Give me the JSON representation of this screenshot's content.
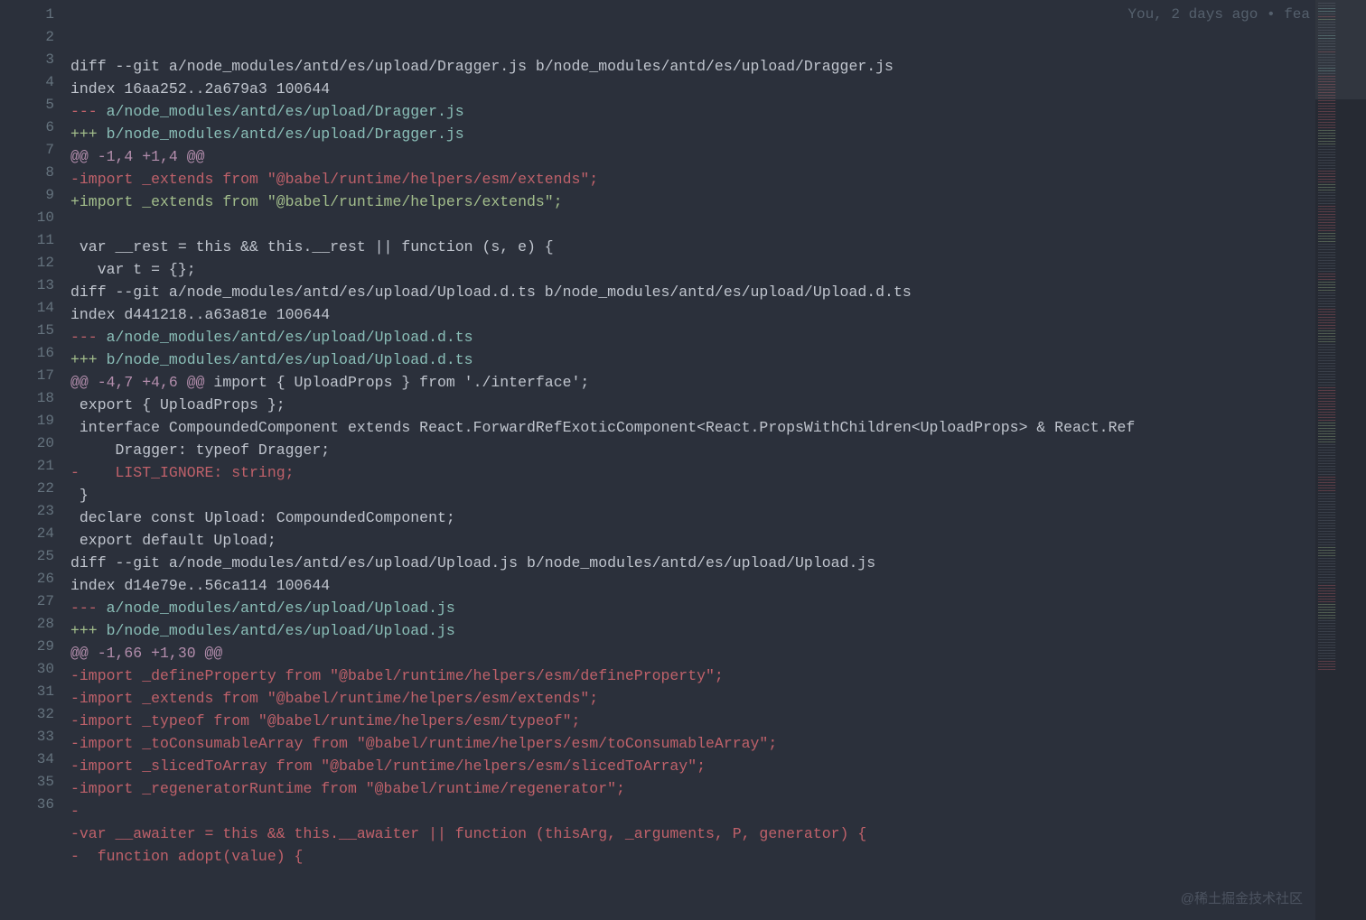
{
  "blame": "You, 2 days ago • fea",
  "watermark": "@稀土掘金技术社区",
  "lines": [
    {
      "n": 1,
      "cls": "header",
      "spans": [
        {
          "c": "c-plain",
          "t": "diff --git a/node_modules/antd/es/upload/Dragger.js b/node_modules/antd/es/upload/Dragger.js"
        }
      ]
    },
    {
      "n": 2,
      "cls": "header",
      "spans": [
        {
          "c": "c-plain",
          "t": "index 16aa252..2a679a3 100644"
        }
      ]
    },
    {
      "n": 3,
      "cls": "minusf",
      "spans": [
        {
          "c": "c-minusfile",
          "t": "--- "
        },
        {
          "c": "c-minuspath",
          "t": "a/node_modules/antd/es/upload/Dragger.js"
        }
      ]
    },
    {
      "n": 4,
      "cls": "plusf",
      "spans": [
        {
          "c": "c-plus",
          "t": "+++ "
        },
        {
          "c": "c-pluspath",
          "t": "b/node_modules/antd/es/upload/Dragger.js"
        }
      ]
    },
    {
      "n": 5,
      "cls": "hunk",
      "spans": [
        {
          "c": "c-hunk",
          "t": "@@ -1,4 +1,4 @@"
        }
      ]
    },
    {
      "n": 6,
      "cls": "del",
      "spans": [
        {
          "c": "c-deleted",
          "t": "-import _extends from \"@babel/runtime/helpers/esm/extends\";"
        }
      ]
    },
    {
      "n": 7,
      "cls": "add",
      "spans": [
        {
          "c": "c-added",
          "t": "+import _extends from \"@babel/runtime/helpers/extends\";"
        }
      ]
    },
    {
      "n": 8,
      "cls": "ctx",
      "spans": [
        {
          "c": "c-plain",
          "t": " "
        }
      ]
    },
    {
      "n": 9,
      "cls": "ctx",
      "spans": [
        {
          "c": "c-plain",
          "t": " var __rest = this && this.__rest || function (s, e) {"
        }
      ]
    },
    {
      "n": 10,
      "cls": "ctx",
      "spans": [
        {
          "c": "c-plain",
          "t": "   var t = {};"
        }
      ]
    },
    {
      "n": 11,
      "cls": "header",
      "spans": [
        {
          "c": "c-plain",
          "t": "diff --git a/node_modules/antd/es/upload/Upload.d.ts b/node_modules/antd/es/upload/Upload.d.ts"
        }
      ]
    },
    {
      "n": 12,
      "cls": "header",
      "spans": [
        {
          "c": "c-plain",
          "t": "index d441218..a63a81e 100644"
        }
      ]
    },
    {
      "n": 13,
      "cls": "minusf",
      "spans": [
        {
          "c": "c-minusfile",
          "t": "--- "
        },
        {
          "c": "c-minuspath",
          "t": "a/node_modules/antd/es/upload/Upload.d.ts"
        }
      ]
    },
    {
      "n": 14,
      "cls": "plusf",
      "spans": [
        {
          "c": "c-plus",
          "t": "+++ "
        },
        {
          "c": "c-pluspath",
          "t": "b/node_modules/antd/es/upload/Upload.d.ts"
        }
      ]
    },
    {
      "n": 15,
      "cls": "hunk",
      "spans": [
        {
          "c": "c-hunk",
          "t": "@@ -4,7 +4,6 @@"
        },
        {
          "c": "c-plain",
          "t": " import { UploadProps } from './interface';"
        }
      ]
    },
    {
      "n": 16,
      "cls": "ctx",
      "spans": [
        {
          "c": "c-plain",
          "t": " export { UploadProps };"
        }
      ]
    },
    {
      "n": 17,
      "cls": "ctx",
      "spans": [
        {
          "c": "c-plain",
          "t": " interface CompoundedComponent extends React.ForwardRefExoticComponent<React.PropsWithChildren<UploadProps> & React.Ref"
        }
      ]
    },
    {
      "n": 18,
      "cls": "ctx",
      "spans": [
        {
          "c": "c-plain",
          "t": "     Dragger: typeof Dragger;"
        }
      ]
    },
    {
      "n": 19,
      "cls": "del",
      "spans": [
        {
          "c": "c-deleted",
          "t": "-    LIST_IGNORE: string;"
        }
      ]
    },
    {
      "n": 20,
      "cls": "ctx",
      "spans": [
        {
          "c": "c-plain",
          "t": " }"
        }
      ]
    },
    {
      "n": 21,
      "cls": "ctx",
      "spans": [
        {
          "c": "c-plain",
          "t": " declare const Upload: CompoundedComponent;"
        }
      ]
    },
    {
      "n": 22,
      "cls": "ctx",
      "spans": [
        {
          "c": "c-plain",
          "t": " export default Upload;"
        }
      ]
    },
    {
      "n": 23,
      "cls": "header",
      "spans": [
        {
          "c": "c-plain",
          "t": "diff --git a/node_modules/antd/es/upload/Upload.js b/node_modules/antd/es/upload/Upload.js"
        }
      ]
    },
    {
      "n": 24,
      "cls": "header",
      "spans": [
        {
          "c": "c-plain",
          "t": "index d14e79e..56ca114 100644"
        }
      ]
    },
    {
      "n": 25,
      "cls": "minusf",
      "spans": [
        {
          "c": "c-minusfile",
          "t": "--- "
        },
        {
          "c": "c-minuspath",
          "t": "a/node_modules/antd/es/upload/Upload.js"
        }
      ]
    },
    {
      "n": 26,
      "cls": "plusf",
      "spans": [
        {
          "c": "c-plus",
          "t": "+++ "
        },
        {
          "c": "c-pluspath",
          "t": "b/node_modules/antd/es/upload/Upload.js"
        }
      ]
    },
    {
      "n": 27,
      "cls": "hunk",
      "spans": [
        {
          "c": "c-hunk",
          "t": "@@ -1,66 +1,30 @@"
        }
      ]
    },
    {
      "n": 28,
      "cls": "del",
      "spans": [
        {
          "c": "c-deleted",
          "t": "-import _defineProperty from \"@babel/runtime/helpers/esm/defineProperty\";"
        }
      ]
    },
    {
      "n": 29,
      "cls": "del",
      "spans": [
        {
          "c": "c-deleted",
          "t": "-import _extends from \"@babel/runtime/helpers/esm/extends\";"
        }
      ]
    },
    {
      "n": 30,
      "cls": "del",
      "spans": [
        {
          "c": "c-deleted",
          "t": "-import _typeof from \"@babel/runtime/helpers/esm/typeof\";"
        }
      ]
    },
    {
      "n": 31,
      "cls": "del",
      "spans": [
        {
          "c": "c-deleted",
          "t": "-import _toConsumableArray from \"@babel/runtime/helpers/esm/toConsumableArray\";"
        }
      ]
    },
    {
      "n": 32,
      "cls": "del",
      "spans": [
        {
          "c": "c-deleted",
          "t": "-import _slicedToArray from \"@babel/runtime/helpers/esm/slicedToArray\";"
        }
      ]
    },
    {
      "n": 33,
      "cls": "del",
      "spans": [
        {
          "c": "c-deleted",
          "t": "-import _regeneratorRuntime from \"@babel/runtime/regenerator\";"
        }
      ]
    },
    {
      "n": 34,
      "cls": "del",
      "spans": [
        {
          "c": "c-deleted",
          "t": "-"
        }
      ]
    },
    {
      "n": 35,
      "cls": "del",
      "spans": [
        {
          "c": "c-deleted",
          "t": "-var __awaiter = this && this.__awaiter || function (thisArg, _arguments, P, generator) {"
        }
      ]
    },
    {
      "n": 36,
      "cls": "del",
      "spans": [
        {
          "c": "c-deleted",
          "t": "-  function adopt(value) {"
        }
      ]
    }
  ],
  "minimap_pattern": [
    "gray",
    "gray",
    "cyan",
    "cyan",
    "gray",
    "red",
    "green",
    "gray",
    "gray",
    "gray",
    "gray",
    "gray",
    "cyan",
    "cyan",
    "gray",
    "gray",
    "gray",
    "gray",
    "red",
    "gray",
    "gray",
    "gray",
    "gray",
    "gray",
    "cyan",
    "cyan",
    "gray",
    "red",
    "red",
    "red",
    "red",
    "red",
    "red",
    "red",
    "red",
    "red",
    "red",
    "red",
    "red",
    "red",
    "red",
    "red",
    "red",
    "red",
    "red",
    "red",
    "red",
    "green",
    "green",
    "green",
    "green",
    "green",
    "green",
    "gray",
    "gray",
    "gray",
    "gray",
    "gray",
    "gray",
    "gray",
    "gray",
    "gray",
    "red",
    "red",
    "red",
    "red",
    "red",
    "green",
    "green",
    "green",
    "gray",
    "gray",
    "gray",
    "gray",
    "gray",
    "red",
    "red",
    "red",
    "red",
    "red",
    "red",
    "red",
    "red",
    "red",
    "red",
    "green",
    "green",
    "green",
    "green",
    "gray",
    "gray",
    "gray",
    "gray",
    "gray",
    "gray",
    "gray",
    "gray",
    "gray",
    "gray",
    "gray",
    "red",
    "red",
    "red",
    "green",
    "green",
    "green",
    "green",
    "gray",
    "gray",
    "gray",
    "gray",
    "gray",
    "gray",
    "red",
    "red",
    "red",
    "red",
    "red",
    "red",
    "red",
    "red",
    "green",
    "green",
    "green",
    "green",
    "green",
    "gray",
    "gray",
    "gray",
    "gray",
    "gray",
    "gray",
    "gray",
    "gray",
    "gray",
    "gray",
    "gray",
    "gray",
    "gray",
    "gray",
    "gray",
    "gray",
    "red",
    "red",
    "red",
    "red",
    "red",
    "red",
    "red",
    "red",
    "red",
    "red",
    "red",
    "red",
    "red",
    "green",
    "green",
    "green",
    "green",
    "green",
    "green",
    "green",
    "green",
    "gray",
    "gray",
    "gray",
    "gray",
    "gray",
    "gray",
    "gray",
    "gray",
    "gray",
    "gray",
    "gray",
    "gray",
    "red",
    "red",
    "red",
    "red",
    "red",
    "red",
    "gray",
    "gray",
    "gray",
    "gray",
    "gray",
    "gray",
    "gray",
    "gray",
    "gray",
    "gray",
    "gray",
    "gray",
    "gray",
    "gray",
    "gray",
    "gray",
    "gray",
    "gray",
    "gray",
    "gray",
    "green",
    "green",
    "green",
    "green",
    "gray",
    "gray",
    "gray",
    "gray",
    "gray",
    "gray",
    "gray",
    "gray",
    "gray",
    "gray",
    "red",
    "red",
    "red",
    "red",
    "red",
    "red",
    "red",
    "green",
    "green",
    "green",
    "green",
    "green",
    "green",
    "gray",
    "gray",
    "gray",
    "gray",
    "gray",
    "gray",
    "gray",
    "gray",
    "gray",
    "gray",
    "gray",
    "gray",
    "gray",
    "gray",
    "gray",
    "red",
    "red",
    "red",
    "red"
  ]
}
